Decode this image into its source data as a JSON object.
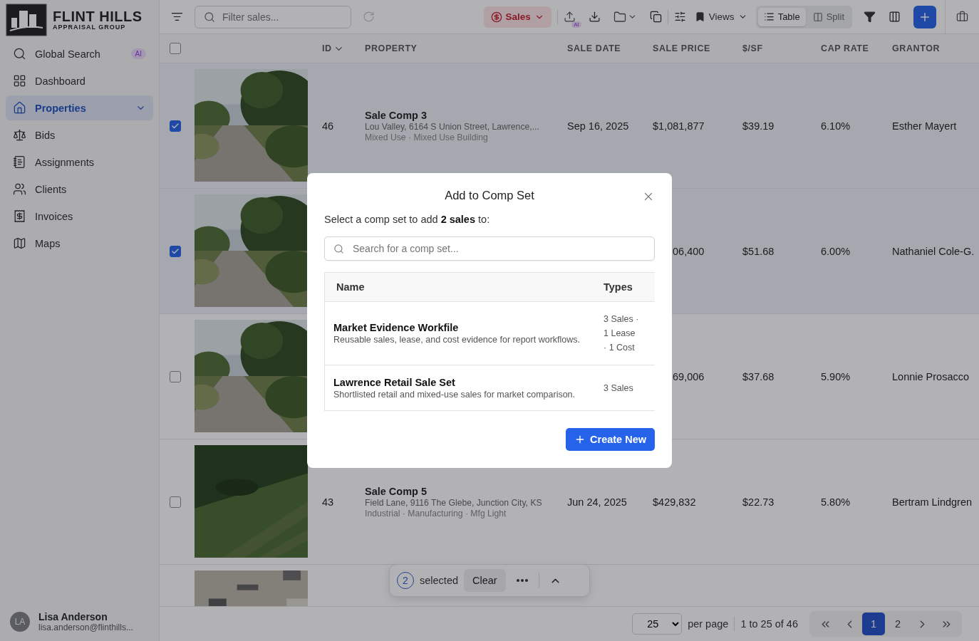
{
  "sidebar": {
    "logo": {
      "title": "FLINT HILLS",
      "subtitle": "APPRAISAL GROUP"
    },
    "items": [
      {
        "label": "Global Search",
        "kind": "search",
        "badge": "AI",
        "selected": false
      },
      {
        "label": "Dashboard",
        "kind": "dashboard",
        "selected": false
      },
      {
        "label": "Properties",
        "kind": "properties",
        "selected": true,
        "expandable": true
      },
      {
        "label": "Bids",
        "kind": "bids",
        "selected": false
      },
      {
        "label": "Assignments",
        "kind": "assignments",
        "selected": false
      },
      {
        "label": "Clients",
        "kind": "clients",
        "selected": false
      },
      {
        "label": "Invoices",
        "kind": "invoices",
        "selected": false
      },
      {
        "label": "Maps",
        "kind": "maps",
        "selected": false
      }
    ],
    "user": {
      "initials": "LA",
      "name": "Lisa Anderson",
      "email": "lisa.anderson@flinthills..."
    }
  },
  "toolbar": {
    "search": {
      "placeholder": "Filter sales..."
    },
    "type_menu": {
      "label": "Sales"
    },
    "upload_badge": "AI",
    "views": {
      "label": "Views"
    },
    "view_modes": [
      {
        "label": "Table",
        "kind": "list",
        "selected": true
      },
      {
        "label": "Split",
        "kind": "split",
        "selected": false
      }
    ]
  },
  "table": {
    "columns": [
      {
        "label": "ID",
        "sorted": true
      },
      {
        "label": "PROPERTY",
        "sorted": false
      },
      {
        "label": "SALE DATE",
        "sorted": false
      },
      {
        "label": "SALE PRICE",
        "sorted": false
      },
      {
        "label": "$/SF",
        "sorted": false
      },
      {
        "label": "CAP RATE",
        "sorted": false
      },
      {
        "label": "GRANTOR",
        "sorted": false
      }
    ],
    "all_selected": false,
    "rows": [
      {
        "selected": true,
        "kind": "picture",
        "id": "46",
        "name": "Sale Comp 3",
        "address": "Lou Valley, 6164 S Union Street, Lawrence,...",
        "type": "Mixed Use · Mixed Use Building",
        "sale_date": "Sep 16, 2025",
        "sale_price": "$1,081,877",
        "psf": "$39.19",
        "cap_rate": "6.10%",
        "grantor": "Esther Mayert"
      },
      {
        "selected": true,
        "kind": "picture",
        "sale_price_cut": "06,400",
        "psf": "$51.68",
        "cap_rate": "6.00%",
        "grantor": "Nathaniel Cole-G."
      },
      {
        "selected": false,
        "kind": "picture",
        "sale_price_cut": "69,006",
        "psf": "$37.68",
        "cap_rate": "5.90%",
        "grantor": "Lonnie Prosacco"
      },
      {
        "selected": false,
        "kind": "picture",
        "id": "43",
        "name": "Sale Comp 5",
        "address": "Field Lane, 9116 The Glebe, Junction City, KS",
        "type": "Industrial · Manufacturing · Mfg Light",
        "sale_date": "Jun 24, 2025",
        "sale_price": "$429,832",
        "psf": "$22.73",
        "cap_rate": "5.80%",
        "grantor": "Bertram Lindgren"
      },
      {
        "kind": "picture"
      }
    ]
  },
  "selection_bar": {
    "count": "2",
    "label": "selected",
    "clear": "Clear"
  },
  "pagination": {
    "page_size": "25",
    "per_page_label": "per page",
    "range": "1 to 25 of 46",
    "pages": [
      {
        "label": "1",
        "selected": true
      },
      {
        "label": "2",
        "selected": false
      }
    ]
  },
  "dialog": {
    "title": "Add to Comp Set",
    "subtitle": "Select a comp set to add **2 sales** to:",
    "search": {
      "placeholder": "Search for a comp set..."
    },
    "columns": [
      "Name",
      "Types"
    ],
    "rows": [
      {
        "name": "Market Evidence Workfile",
        "description": "Reusable sales, lease, and cost evidence for report workflows.",
        "types": "3 Sales · 1 Lease · 1 Cost"
      },
      {
        "name": "Lawrence Retail Sale Set",
        "description": "Shortlisted retail and mixed-use sales for market comparison.",
        "types": "3 Sales"
      }
    ],
    "create_label": "Create New"
  }
}
